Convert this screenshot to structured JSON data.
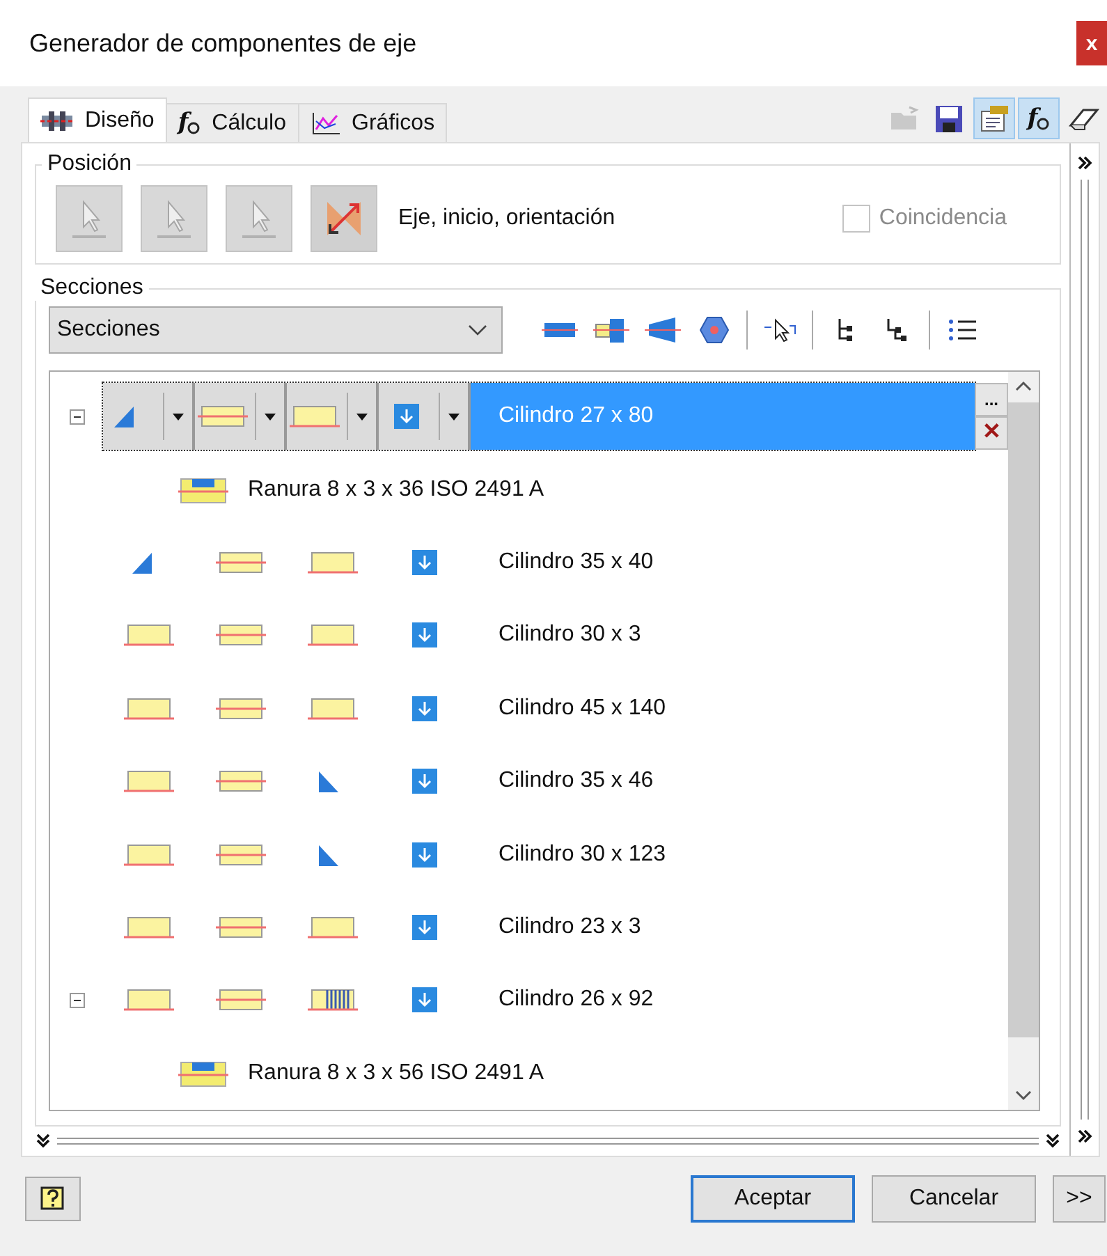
{
  "window": {
    "title": "Generador de componentes de eje",
    "close": "x"
  },
  "tabs": [
    {
      "label": "Diseño",
      "kind": "design",
      "selected": true
    },
    {
      "label": "Cálculo",
      "kind": "calc",
      "glyph": "f",
      "selected": false
    },
    {
      "label": "Gráficos",
      "kind": "graph",
      "selected": false
    }
  ],
  "top_toolbar": [
    {
      "kind": "folder",
      "on": false,
      "disabled": true
    },
    {
      "kind": "save",
      "on": false,
      "disabled": false
    },
    {
      "kind": "params",
      "on": true,
      "disabled": false
    },
    {
      "kind": "formula",
      "glyph": "f",
      "on": true,
      "disabled": false
    },
    {
      "kind": "eraser",
      "on": false,
      "disabled": false
    }
  ],
  "position": {
    "title": "Posición",
    "buttons": [
      {
        "disabled": true
      },
      {
        "disabled": true
      },
      {
        "disabled": true
      },
      {
        "disabled": false
      }
    ],
    "label": "Eje, inicio, orientación",
    "coincidence": {
      "label": "Coincidencia",
      "checked": false,
      "disabled": true
    }
  },
  "sections": {
    "title": "Secciones",
    "dropdown": "Secciones",
    "toolbar": [
      {
        "kind": "cylinder"
      },
      {
        "kind": "stepped"
      },
      {
        "kind": "cone"
      },
      {
        "kind": "polygon"
      },
      {
        "kind": "separator"
      },
      {
        "kind": "select"
      },
      {
        "kind": "separator"
      },
      {
        "kind": "treea"
      },
      {
        "kind": "treeb"
      },
      {
        "kind": "separator"
      },
      {
        "kind": "list"
      }
    ],
    "rows": [
      {
        "icons": [
          {
            "kind": "chamfer"
          },
          {
            "kind": "centered"
          },
          {
            "kind": "plain"
          },
          {
            "kind": "arrow"
          }
        ],
        "label": "Cilindro 27 x 80",
        "selected": true,
        "expanded": true,
        "children": [
          {
            "label": "Ranura 8 x 3 x 36 ISO 2491 A"
          }
        ]
      },
      {
        "icons": [
          {
            "kind": "chamfer"
          },
          {
            "kind": "centered"
          },
          {
            "kind": "plain"
          },
          {
            "kind": "arrow"
          }
        ],
        "label": "Cilindro 35 x 40",
        "selected": false
      },
      {
        "icons": [
          {
            "kind": "plain"
          },
          {
            "kind": "centered"
          },
          {
            "kind": "plain"
          },
          {
            "kind": "arrow"
          }
        ],
        "label": "Cilindro 30 x 3",
        "selected": false
      },
      {
        "icons": [
          {
            "kind": "plain"
          },
          {
            "kind": "centered"
          },
          {
            "kind": "plain"
          },
          {
            "kind": "arrow"
          }
        ],
        "label": "Cilindro 45 x 140",
        "selected": false
      },
      {
        "icons": [
          {
            "kind": "plain"
          },
          {
            "kind": "centered"
          },
          {
            "kind": "corner"
          },
          {
            "kind": "arrow"
          }
        ],
        "label": "Cilindro 35 x 46",
        "selected": false
      },
      {
        "icons": [
          {
            "kind": "plain"
          },
          {
            "kind": "centered"
          },
          {
            "kind": "corner"
          },
          {
            "kind": "arrow"
          }
        ],
        "label": "Cilindro 30 x 123",
        "selected": false
      },
      {
        "icons": [
          {
            "kind": "plain"
          },
          {
            "kind": "centered"
          },
          {
            "kind": "plain"
          },
          {
            "kind": "arrow"
          }
        ],
        "label": "Cilindro 23 x 3",
        "selected": false
      },
      {
        "icons": [
          {
            "kind": "plain"
          },
          {
            "kind": "centered"
          },
          {
            "kind": "thread"
          },
          {
            "kind": "arrow"
          }
        ],
        "label": "Cilindro 26 x 92",
        "selected": false,
        "expanded": true,
        "children": [
          {
            "label": "Ranura 8 x 3 x 56 ISO 2491 A"
          }
        ]
      }
    ],
    "more": "...",
    "delete": "✕"
  },
  "footer": {
    "ok": "Aceptar",
    "cancel": "Cancelar",
    "more": ">>"
  }
}
